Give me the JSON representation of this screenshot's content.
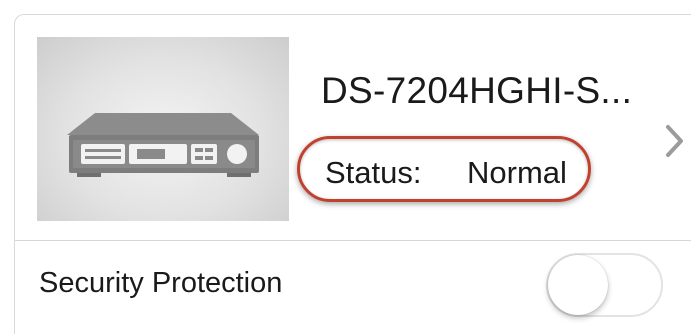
{
  "device": {
    "name": "DS-7204HGHI-S...",
    "status_label": "Status:",
    "status_value": "Normal",
    "image_icon": "dvr-recorder-icon",
    "arrow_icon": "chevron-right-icon"
  },
  "settings": {
    "security_protection_label": "Security Protection",
    "security_protection_enabled": false
  },
  "colors": {
    "status_highlight": "#c0412f",
    "chevron": "#9b9b9b",
    "toggle_off_border": "#e3e3e3"
  }
}
